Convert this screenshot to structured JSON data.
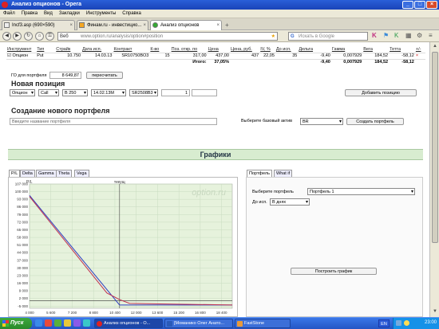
{
  "window": {
    "title": "Анализ опционов - Opera"
  },
  "menu": [
    "Файл",
    "Правка",
    "Вид",
    "Закладки",
    "Инструменты",
    "Справка"
  ],
  "tabs": [
    {
      "label": "Inсf3.asp (690×590)"
    },
    {
      "label": "Финам.ru - инвестицио..."
    },
    {
      "label": "Анализ опционов"
    }
  ],
  "address": {
    "web_label": "Веб",
    "url": "www.option.ru/analysis/option#position"
  },
  "search": {
    "placeholder": "Искать в Google"
  },
  "positions": {
    "headers": [
      "Инструмент",
      "Тип",
      "Страйк",
      "Дата исп.",
      "Контракт",
      "К-во",
      "Поз. откр. по",
      "Цена",
      "Цена, руб.",
      "IV, %",
      "До исп.",
      "Дельта",
      "Гамма",
      "Вега",
      "Тетта",
      "+/-"
    ],
    "row": {
      "instrument": "Опцион",
      "type": "Put",
      "strike": "10.750",
      "date": "14.03.13",
      "contract": "SR10750BO3",
      "qty": "15",
      "open": "317,00",
      "price": "437,00",
      "price_rub": "437",
      "iv": "22,05",
      "days": "35",
      "delta": "-9,40",
      "gamma": "0,007929",
      "vega": "184,52",
      "theta": "-58,12"
    },
    "total": {
      "label": "Итого:",
      "iv": "37,05%",
      "delta": "-9,40",
      "gamma": "0,007929",
      "vega": "184,52",
      "theta": "-58,12"
    },
    "go_label": "ГО для портфеля",
    "go_value": "8 649,87",
    "recalc_button": "пересчитать"
  },
  "new_position": {
    "title": "Новая позиция",
    "instrument": "Опцион",
    "type": "Call",
    "series": "В 250",
    "date": "14.02.13М",
    "contract": "SR2508B3",
    "qty": "1",
    "add_button": "Добавить позицию"
  },
  "new_portfolio": {
    "title": "Создание нового портфеля",
    "name_placeholder": "Введите название портфеля",
    "asset_label": "Выберите базовый актив",
    "asset_value": "BR",
    "create_button": "Создать портфель"
  },
  "graphs": {
    "title": "Графики",
    "tabs": [
      "P/L",
      "Delta",
      "Gamma",
      "Theta",
      "Vega"
    ],
    "side_tabs": [
      "Портфель",
      "What if"
    ],
    "portfolio_label": "Выберите портфель",
    "portfolio_value": "Портфель 1",
    "until_label": "До исп.",
    "until_value": "В днях",
    "build_button": "Построить график",
    "watermark": "option.ru",
    "current_label": "текущ"
  },
  "chart_data": {
    "type": "line",
    "title": "",
    "ylabel": "P/L",
    "xlim": [
      4000,
      19200
    ],
    "ylim": [
      -7000,
      107000
    ],
    "x_ticks": [
      4000,
      5600,
      7200,
      8800,
      10400,
      12000,
      13600,
      15200,
      16800,
      18400
    ],
    "y_ticks": [
      107000,
      100000,
      93000,
      86000,
      79000,
      72000,
      65000,
      58000,
      51000,
      44000,
      37000,
      30000,
      23000,
      16000,
      9000,
      2000,
      -5000
    ],
    "current_x": 10750,
    "series": [
      {
        "values_x": [
          4000,
          10750,
          19200
        ],
        "values_y": [
          96500,
          -4000,
          -4000
        ],
        "color": "#3040c0"
      },
      {
        "values_x": [
          4000,
          9800,
          10750,
          11500,
          19200
        ],
        "values_y": [
          95500,
          7000,
          1000,
          -2500,
          -4000
        ],
        "color": "#c03050"
      }
    ]
  },
  "taskbar": {
    "start": "Пуск",
    "items": [
      "Анализ опционов - O...",
      "[Моманико Олег Анато...",
      "FastStone"
    ],
    "lang": "EN",
    "clock": "23:00"
  },
  "colors": {
    "accent_green": "#d8ecd0",
    "chart_fill": "#e6f2dc",
    "blue_line": "#3040c0",
    "red_line": "#c03050"
  }
}
